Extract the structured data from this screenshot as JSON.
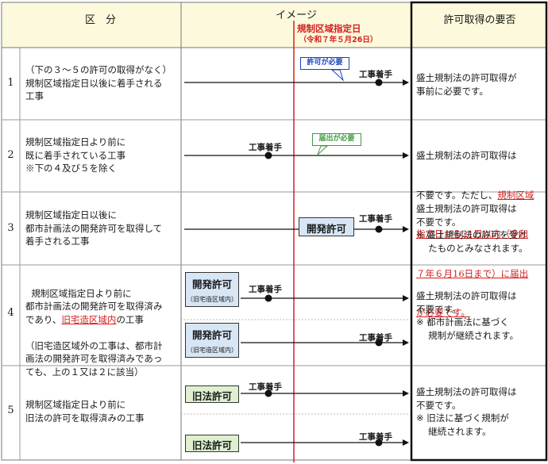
{
  "header": {
    "col1": "区　分",
    "col2": "イメージ",
    "col3": "許可取得の要否"
  },
  "designation": {
    "title": "規制区域指定日",
    "date": "（令和７年５月26日）"
  },
  "rows": [
    {
      "num": "1",
      "text": "（下の３～５の許可の取得がなく）\n規制区域指定日以後に着手される\n工事",
      "callout": "許可が必要",
      "start": "工事着手",
      "req": "盛土規制法の許可取得が\n事前に必要です。"
    },
    {
      "num": "2",
      "text": "規制区域指定日より前に\n既に着手されている工事\n※下の４及び５を除く",
      "callout": "届出が必要",
      "start": "工事着手",
      "req_line1": "盛土規制法の許可取得は",
      "req_line2a": "不要です。ただし、",
      "req_red1": "規制区域",
      "req_red2": "指定日から21日以内（令和",
      "req_red3": "７年６月16日まで）に届出",
      "req_red4": "が必要です。"
    },
    {
      "num": "3",
      "text": "規制区域指定日以後に\n都市計画法の開発許可を取得して\n着手される工事",
      "permit": "開発許可",
      "start": "工事着手",
      "req": "盛土規制法の許可取得は\n不要です。\n※ 盛土規制法の許可を受け\n　 たものとみなされます。"
    },
    {
      "num": "4",
      "text_a": "規制区域指定日より前に\n都市計画法の開発許可を取得済み\nであり、",
      "text_red": "旧宅造区域内",
      "text_b": "の工事",
      "text_c": "（旧宅造区域外の工事は、都市計\n画法の開発許可を取得済みであっ\nても、上の１又は２に該当）",
      "permit": "開発許可",
      "permit_sub": "（旧宅造区域内）",
      "start": "工事着手",
      "req": "盛土規制法の許可取得は\n不要です。\n※ 都市計画法に基づく\n　 規制が継続されます。"
    },
    {
      "num": "5",
      "text": "規制区域指定日より前に\n旧法の許可を取得済みの工事",
      "permit": "旧法許可",
      "start": "工事着手",
      "req": "盛土規制法の許可取得は\n不要です。\n※ 旧法に基づく規制が\n　 継続されます。"
    }
  ],
  "colors": {
    "header_bg": "#fdf9dc",
    "red_line": "#d42020",
    "callout_blue": "#1a3fbf",
    "callout_green": "#3f9a3f",
    "permit_blue_bg": "#d7e6f5",
    "permit_green_bg": "#def0cf"
  }
}
